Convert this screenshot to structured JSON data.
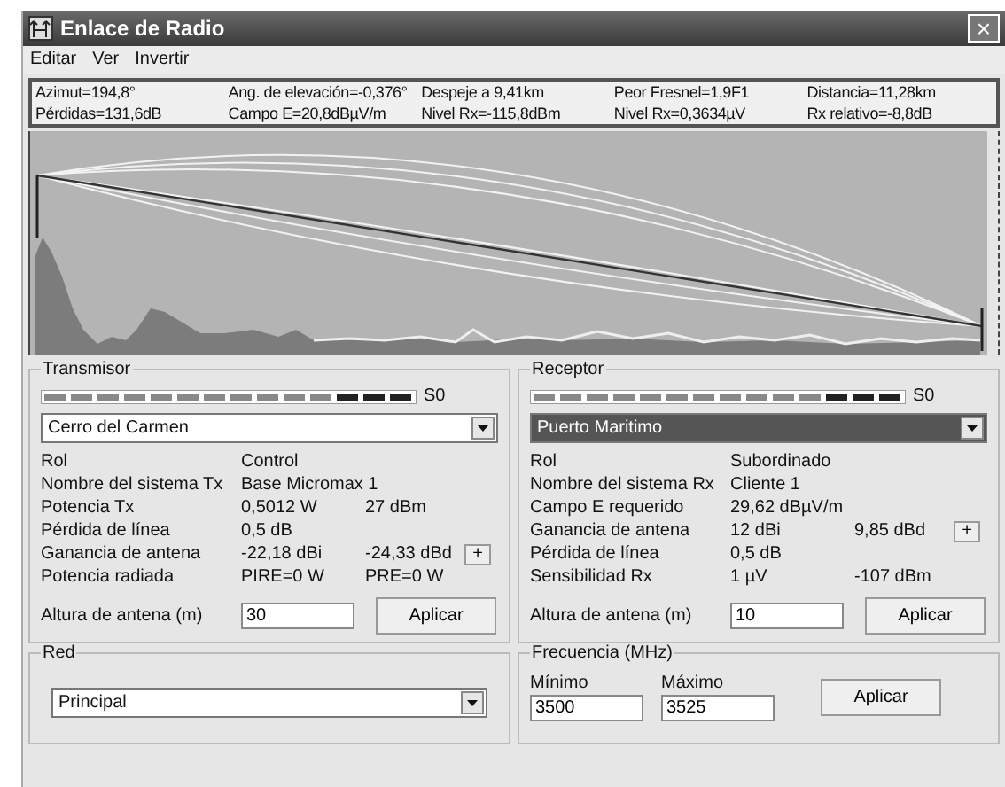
{
  "window": {
    "title": "Enlace de Radio",
    "close": "×"
  },
  "menu": [
    "Editar",
    "Ver",
    "Invertir"
  ],
  "summary": [
    [
      "Azimut=194,8°",
      "Ang. de elevación=-0,376°",
      "Despeje a 9,41km",
      "Peor Fresnel=1,9F1",
      "Distancia=11,28km"
    ],
    [
      "Pérdidas=131,6dB",
      "Campo E=20,8dBµV/m",
      "Nivel Rx=-115,8dBm",
      "Nivel Rx=0,3634µV",
      "Rx relativo=-8,8dB"
    ]
  ],
  "transmitter": {
    "title": "Transmisor",
    "meter_label": "S0",
    "site": {
      "value": "Cerro del Carmen",
      "highlighted": false
    },
    "rows": [
      {
        "label": "Rol",
        "value": "Control"
      },
      {
        "label": "Nombre del sistema Tx",
        "value": "Base Micromax 1"
      },
      {
        "label": "Potencia Tx",
        "value": "0,5012 W",
        "extra": "27 dBm"
      },
      {
        "label": "Pérdida de línea",
        "value": "0,5 dB"
      },
      {
        "label": "Ganancia de antena",
        "value": "-22,18 dBi",
        "extra": "-24,33 dBd",
        "button": "+"
      },
      {
        "label": "Potencia radiada",
        "value": "PIRE=0 W",
        "extra": "PRE=0 W"
      }
    ],
    "height": {
      "label": "Altura de antena (m)",
      "value": "30"
    },
    "apply": "Aplicar"
  },
  "receiver": {
    "title": "Receptor",
    "meter_label": "S0",
    "site": {
      "value": "Puerto Maritimo",
      "highlighted": true
    },
    "rows": [
      {
        "label": "Rol",
        "value": "Subordinado"
      },
      {
        "label": "Nombre del sistema Rx",
        "value": "Cliente 1"
      },
      {
        "label": "Campo E requerido",
        "value": "29,62 dBµV/m"
      },
      {
        "label": "Ganancia de antena",
        "value": "12 dBi",
        "extra": "9,85 dBd",
        "button": "+"
      },
      {
        "label": "Pérdida de línea",
        "value": "0,5 dB"
      },
      {
        "label": "Sensibilidad Rx",
        "value": "1 µV",
        "extra": "-107 dBm"
      }
    ],
    "height": {
      "label": "Altura de antena (m)",
      "value": "10"
    },
    "apply": "Aplicar"
  },
  "network": {
    "title": "Red",
    "value": "Principal"
  },
  "frequency": {
    "title": "Frecuencia (MHz)",
    "min": {
      "label": "Mínimo",
      "value": "3500"
    },
    "max": {
      "label": "Máximo",
      "value": "3525"
    },
    "apply": "Aplicar"
  }
}
